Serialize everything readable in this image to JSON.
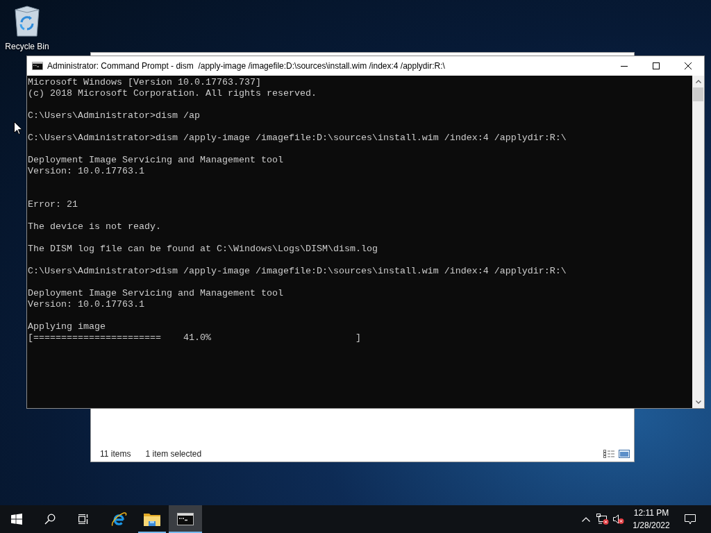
{
  "desktop": {
    "icons": [
      {
        "label": "Recycle Bin"
      }
    ]
  },
  "explorer_window": {
    "status_bar": {
      "item_count": "11 items",
      "selection": "1 item selected"
    }
  },
  "command_prompt": {
    "title": "Administrator: Command Prompt - dism  /apply-image /imagefile:D:\\sources\\install.wim /index:4 /applydir:R:\\",
    "lines": [
      {
        "kind": "text",
        "text": "Microsoft Windows [Version 10.0.17763.737]"
      },
      {
        "kind": "text",
        "text": "(c) 2018 Microsoft Corporation. All rights reserved."
      },
      {
        "kind": "blank"
      },
      {
        "kind": "text",
        "text": "C:\\Users\\Administrator>dism /ap"
      },
      {
        "kind": "blank"
      },
      {
        "kind": "text",
        "text": "C:\\Users\\Administrator>dism /apply-image /imagefile:D:\\sources\\install.wim /index:4 /applydir:R:\\"
      },
      {
        "kind": "blank"
      },
      {
        "kind": "text",
        "text": "Deployment Image Servicing and Management tool"
      },
      {
        "kind": "text",
        "text": "Version: 10.0.17763.1"
      },
      {
        "kind": "blank"
      },
      {
        "kind": "blank"
      },
      {
        "kind": "text",
        "text": "Error: 21"
      },
      {
        "kind": "blank"
      },
      {
        "kind": "text",
        "text": "The device is not ready."
      },
      {
        "kind": "blank"
      },
      {
        "kind": "text",
        "text": "The DISM log file can be found at C:\\Windows\\Logs\\DISM\\dism.log"
      },
      {
        "kind": "blank"
      },
      {
        "kind": "text",
        "text": "C:\\Users\\Administrator>dism /apply-image /imagefile:D:\\sources\\install.wim /index:4 /applydir:R:\\"
      },
      {
        "kind": "blank"
      },
      {
        "kind": "text",
        "text": "Deployment Image Servicing and Management tool"
      },
      {
        "kind": "text",
        "text": "Version: 10.0.17763.1"
      },
      {
        "kind": "blank"
      },
      {
        "kind": "text",
        "text": "Applying image"
      },
      {
        "kind": "text",
        "text": "[=======================    41.0%                          ]"
      }
    ]
  },
  "taskbar": {
    "items": [
      {
        "kind": "start"
      },
      {
        "kind": "search"
      },
      {
        "kind": "taskview"
      },
      {
        "kind": "browser",
        "running": false,
        "selected": false
      },
      {
        "kind": "folder",
        "running": true,
        "selected": false
      },
      {
        "kind": "console",
        "running": true,
        "selected": true
      }
    ],
    "clock": {
      "time": "12:11 PM",
      "date": "1/28/2022"
    }
  }
}
